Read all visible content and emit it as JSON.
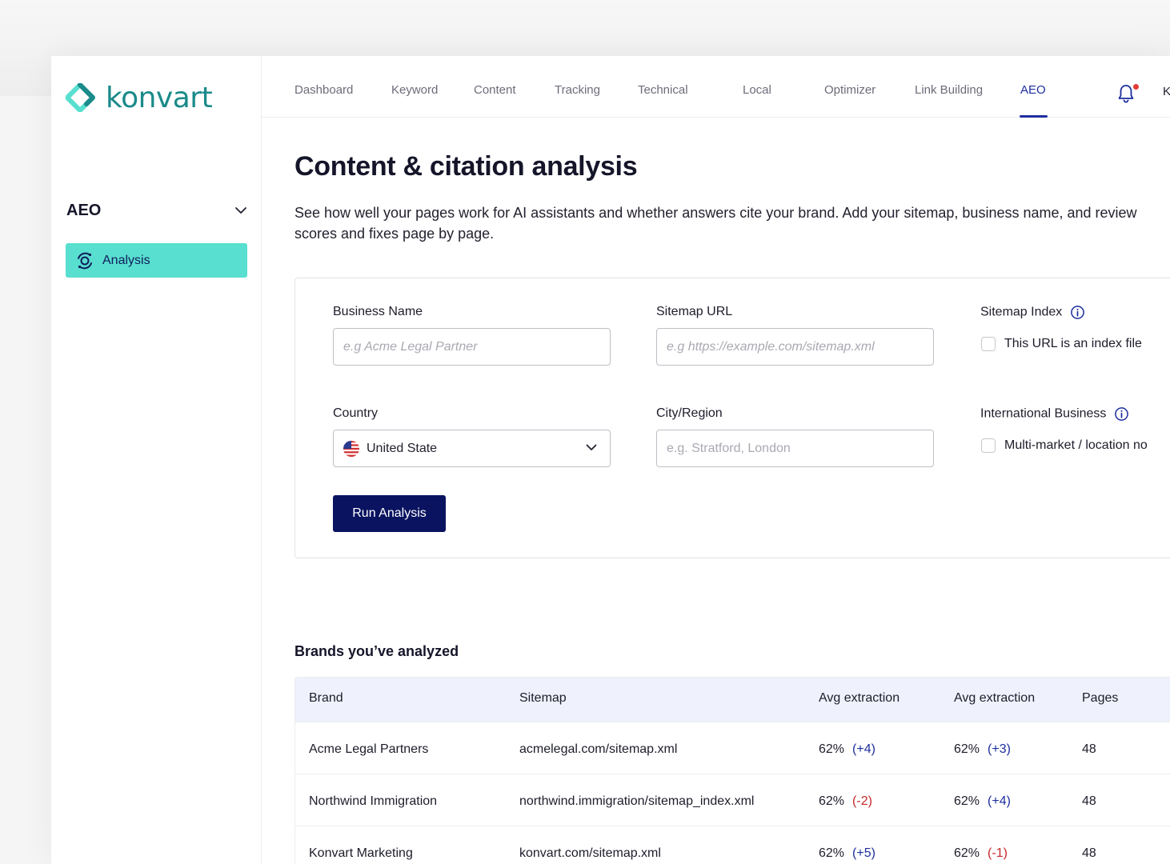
{
  "app": {
    "brand_name": "konvart",
    "brand_color": "#1b8a8a",
    "accent_color": "#1d2e9e",
    "primary_button_color": "#0a1360",
    "active_nav_color": "#58dfcf"
  },
  "sidebar": {
    "section_title": "AEO",
    "items": [
      {
        "label": "Analysis",
        "icon": "analysis-icon",
        "active": true
      }
    ]
  },
  "topnav": {
    "tabs": [
      {
        "label": "Dashboard"
      },
      {
        "label": "Keyword"
      },
      {
        "label": "Content"
      },
      {
        "label": "Tracking"
      },
      {
        "label": "Technical"
      },
      {
        "label": "Local"
      },
      {
        "label": "Optimizer"
      },
      {
        "label": "Link Building"
      },
      {
        "label": "AEO",
        "active": true
      }
    ],
    "user_initial": "K"
  },
  "page": {
    "title": "Content & citation analysis",
    "description": "See how well your pages work for AI assistants and whether answers cite your brand. Add your sitemap, business name, and review scores and fixes page by page."
  },
  "form": {
    "business_name": {
      "label": "Business Name",
      "placeholder": "e.g Acme  Legal Partner",
      "value": ""
    },
    "sitemap_url": {
      "label": "Sitemap URL",
      "placeholder": "e.g https://example.com/sitemap.xml",
      "value": ""
    },
    "sitemap_index": {
      "label": "Sitemap Index",
      "checkbox_label": "This URL is an index file",
      "checked": false
    },
    "country": {
      "label": "Country",
      "value": "United State",
      "flag": "us-flag-icon"
    },
    "city_region": {
      "label": "City/Region",
      "placeholder": "e.g. Stratford, London",
      "value": ""
    },
    "international": {
      "label": "International Business",
      "checkbox_label": "Multi-market / location no",
      "checked": false
    },
    "run_button": "Run Analysis"
  },
  "brands": {
    "title": "Brands you’ve analyzed",
    "columns": [
      "Brand",
      "Sitemap",
      "Avg extraction",
      "Avg extraction",
      "Pages"
    ],
    "positive_color": "#1d2e9e",
    "negative_color": "#c62828",
    "rows": [
      {
        "brand": "Acme Legal Partners",
        "sitemap": "acmelegal.com/sitemap.xml",
        "avg1": "62%",
        "delta1": "(+4)",
        "avg2": "62%",
        "delta2": "(+3)",
        "pages": "48"
      },
      {
        "brand": "Northwind Immigration",
        "sitemap": "northwind.immigration/sitemap_index.xml",
        "avg1": "62%",
        "delta1": "(-2)",
        "avg2": "62%",
        "delta2": "(+4)",
        "pages": "48"
      },
      {
        "brand": "Konvart Marketing",
        "sitemap": "konvart.com/sitemap.xml",
        "avg1": "62%",
        "delta1": "(+5)",
        "avg2": "62%",
        "delta2": "(-1)",
        "pages": "48"
      }
    ]
  }
}
